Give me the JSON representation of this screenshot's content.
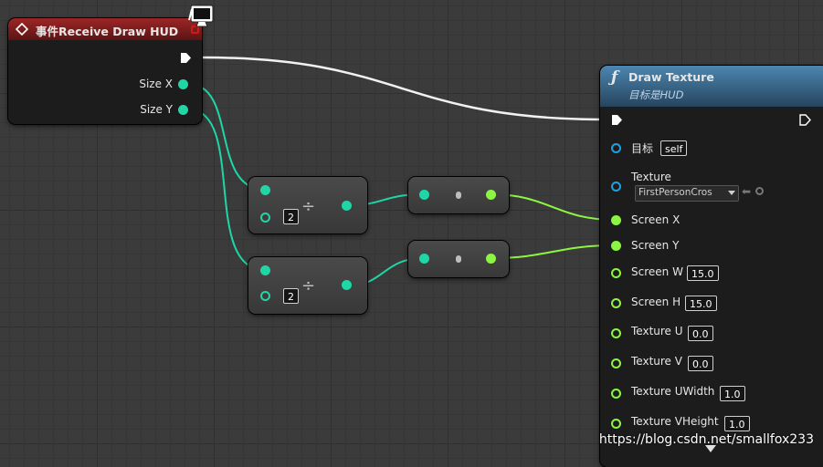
{
  "event_node": {
    "title": "事件Receive Draw HUD",
    "pins": [
      "Size X",
      "Size Y"
    ]
  },
  "divide_nodes": [
    {
      "value": "2",
      "symbol": "÷"
    },
    {
      "value": "2",
      "symbol": "÷"
    }
  ],
  "draw_node": {
    "title": "Draw Texture",
    "subtitle": "目标是HUD",
    "target_label": "目标",
    "target_value": "self",
    "texture_label": "Texture",
    "texture_value": "FirstPersonCros",
    "screen_x": "Screen X",
    "screen_y": "Screen Y",
    "params": [
      {
        "label": "Screen W",
        "value": "15.0"
      },
      {
        "label": "Screen H",
        "value": "15.0"
      },
      {
        "label": "Texture U",
        "value": "0.0"
      },
      {
        "label": "Texture V",
        "value": "0.0"
      },
      {
        "label": "Texture UWidth",
        "value": "1.0"
      },
      {
        "label": "Texture VHeight",
        "value": "1.0"
      }
    ]
  },
  "watermark": "https://blog.csdn.net/smallfox233",
  "colors": {
    "float_pin": "#8cf542",
    "int_pin": "#1fd6a7",
    "object_pin": "#1aa2e8",
    "event_header": "#8a1c1c",
    "function_header": "#3e6f94"
  }
}
